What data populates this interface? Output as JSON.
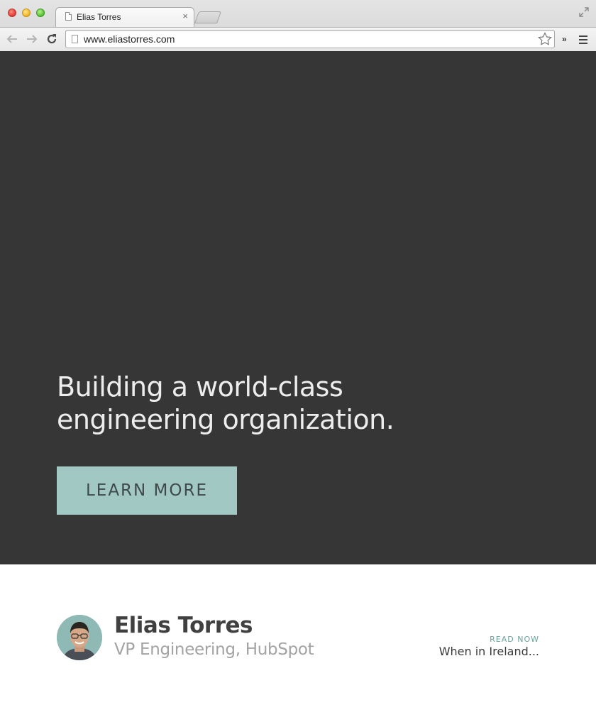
{
  "browser": {
    "tab_title": "Elias Torres",
    "tab_close": "×",
    "url": "www.eliastorres.com",
    "extensions_chevron": "»"
  },
  "hero": {
    "title_line1": "Building a world-class",
    "title_line2": "engineering organization.",
    "cta_label": "LEARN MORE",
    "background_color": "#363636",
    "cta_color": "#a2c8c4"
  },
  "author": {
    "name": "Elias Torres",
    "role": "VP Engineering, HubSpot"
  },
  "featured_post": {
    "kicker": "READ NOW",
    "title": "When in Ireland..."
  },
  "icons": {
    "back": "arrow-left-icon",
    "forward": "arrow-right-icon",
    "reload": "reload-icon",
    "bookmark": "star-icon",
    "menu": "hamburger-menu-icon",
    "page": "page-icon"
  }
}
